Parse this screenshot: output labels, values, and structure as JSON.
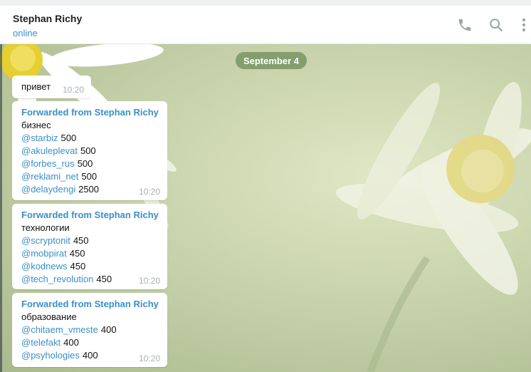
{
  "header": {
    "name": "Stephan Richy",
    "status": "online"
  },
  "date_separator": "September 4",
  "messages": [
    {
      "text": "привет",
      "time": "10:20"
    },
    {
      "forwarded": "Forwarded from Stephan Richy",
      "title": "бизнес",
      "items": [
        {
          "handle": "@starbiz",
          "count": "500"
        },
        {
          "handle": "@akuleplevat",
          "count": "500"
        },
        {
          "handle": "@forbes_rus",
          "count": "500"
        },
        {
          "handle": "@reklami_net",
          "count": "500"
        },
        {
          "handle": "@delaydengi",
          "count": "2500"
        }
      ],
      "time": "10:20"
    },
    {
      "forwarded": "Forwarded from Stephan Richy",
      "title": "технологии",
      "items": [
        {
          "handle": "@scryptonit",
          "count": "450"
        },
        {
          "handle": "@mobpirat",
          "count": "450"
        },
        {
          "handle": "@kodnews",
          "count": "450"
        },
        {
          "handle": "@tech_revolution",
          "count": "450"
        }
      ],
      "time": "10:20"
    },
    {
      "forwarded": "Forwarded from Stephan Richy",
      "title": "образование",
      "items": [
        {
          "handle": "@chitaem_vmeste",
          "count": "400"
        },
        {
          "handle": "@telefakt",
          "count": "400"
        },
        {
          "handle": "@psyhologies",
          "count": "400"
        }
      ],
      "time": "10:20"
    }
  ],
  "icons": {
    "call": "phone-icon",
    "search": "search-icon",
    "menu": "more-vertical-icon"
  }
}
